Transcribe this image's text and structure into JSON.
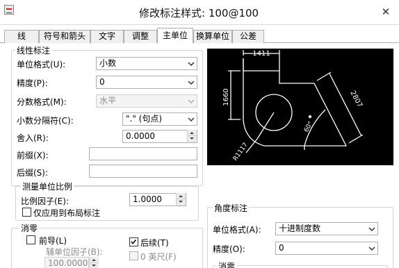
{
  "window": {
    "title": "修改标注样式: 100@100",
    "close_glyph": "✕"
  },
  "tabs": [
    {
      "label": "线"
    },
    {
      "label": "符号和箭头"
    },
    {
      "label": "文字"
    },
    {
      "label": "调整"
    },
    {
      "label": "主单位"
    },
    {
      "label": "换算单位"
    },
    {
      "label": "公差"
    }
  ],
  "active_tab": "主单位",
  "linear": {
    "group_label": "线性标注",
    "unit_format_label": "单位格式(U):",
    "unit_format_value": "小数",
    "precision_label": "精度(P):",
    "precision_value": "0",
    "fraction_format_label": "分数格式(M):",
    "fraction_format_value": "水平",
    "decimal_sep_label": "小数分隔符(C):",
    "decimal_sep_value": "\".\" (句点)",
    "round_off_label": "舍入(R):",
    "round_off_value": "0.0000",
    "prefix_label": "前缀(X):",
    "prefix_value": "",
    "suffix_label": "后缀(S):",
    "suffix_value": ""
  },
  "scale": {
    "group_label": "测量单位比例",
    "factor_label": "比例因子(E):",
    "factor_value": "1.0000",
    "layout_only_label": "仅应用到布局标注",
    "layout_only_checked": false
  },
  "zero_suppression": {
    "group_label": "消零",
    "leading_label": "前导(L)",
    "leading_checked": false,
    "trailing_label": "后续(T)",
    "trailing_checked": true,
    "sub_unit_factor_label": "辅单位因子(B):",
    "sub_unit_factor_value": "100.0000",
    "zero_feet_label": "0 英尺(F)",
    "zero_feet_checked": false
  },
  "angular": {
    "group_label": "角度标注",
    "unit_format_label": "单位格式(A):",
    "unit_format_value": "十进制度数",
    "precision_label": "精度(O):",
    "precision_value": "0",
    "zero_group_label": "消零"
  },
  "preview": {
    "dim_top": "1411",
    "dim_left": "1660",
    "dim_diag": "2807",
    "dim_angle": "60°",
    "dim_radius": "R1117",
    "colors": {
      "bg": "#000000",
      "lines": "#ffffff"
    }
  }
}
